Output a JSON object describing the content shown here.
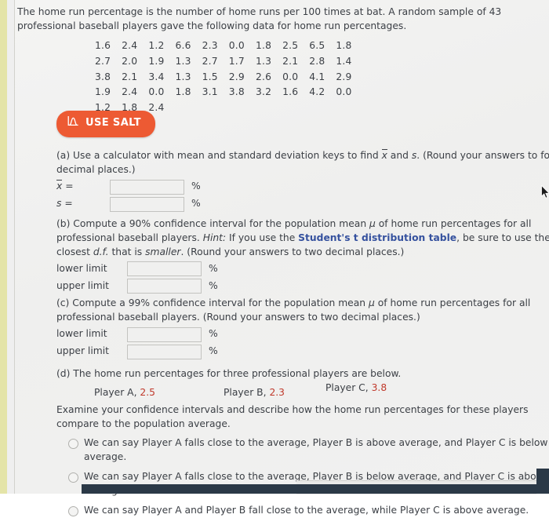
{
  "intro": {
    "text": "The home run percentage is the number of home runs per 100 times at bat. A random sample of 43 professional baseball players gave the following data for home run percentages."
  },
  "data_table": {
    "rows": [
      [
        "1.6",
        "2.4",
        "1.2",
        "6.6",
        "2.3",
        "0.0",
        "1.8",
        "2.5",
        "6.5",
        "1.8"
      ],
      [
        "2.7",
        "2.0",
        "1.9",
        "1.3",
        "2.7",
        "1.7",
        "1.3",
        "2.1",
        "2.8",
        "1.4"
      ],
      [
        "3.8",
        "2.1",
        "3.4",
        "1.3",
        "1.5",
        "2.9",
        "2.6",
        "0.0",
        "4.1",
        "2.9"
      ],
      [
        "1.9",
        "2.4",
        "0.0",
        "1.8",
        "3.1",
        "3.8",
        "3.2",
        "1.6",
        "4.2",
        "0.0"
      ],
      [
        "1.2",
        "1.8",
        "2.4"
      ]
    ]
  },
  "salt_button": {
    "label": "USE SALT",
    "icon": "normal-curve-icon",
    "color": "#ed5a33"
  },
  "part_a": {
    "prompt_1": "(a) Use a calculator with mean and standard deviation keys to find ",
    "symbol_xbar": "x",
    "prompt_2": " and ",
    "symbol_s": "s",
    "prompt_3": ". (Round your answers to four decimal places.)",
    "rows": [
      {
        "label": "x",
        "label_type": "xbar",
        "value": "",
        "unit": "%"
      },
      {
        "label": "s",
        "label_type": "italic",
        "value": "",
        "unit": "%"
      }
    ]
  },
  "part_b": {
    "text_1": "(b) Compute a 90% confidence interval for the population mean ",
    "mu": "μ",
    "text_2": " of home run percentages for all professional baseball players. ",
    "hint_label": "Hint:",
    "text_3": " If you use the ",
    "link": "Student's t distribution table",
    "text_4": ", be sure to use the closest ",
    "df": "d.f.",
    "text_5": " that is ",
    "smaller": "smaller",
    "text_6": ". (Round your answers to two decimal places.)",
    "rows": [
      {
        "label": "lower limit",
        "value": "",
        "unit": "%"
      },
      {
        "label": "upper limit",
        "value": "",
        "unit": "%"
      }
    ]
  },
  "part_c": {
    "text_1": "(c) Compute a 99% confidence interval for the population mean ",
    "mu": "μ",
    "text_2": " of home run percentages for all professional baseball players. (Round your answers to two decimal places.)",
    "rows": [
      {
        "label": "lower limit",
        "value": "",
        "unit": "%"
      },
      {
        "label": "upper limit",
        "value": "",
        "unit": "%"
      }
    ]
  },
  "part_d": {
    "prompt": "(d) The home run percentages for three professional players are below.",
    "players": [
      {
        "name": "Player A,",
        "value": "2.5"
      },
      {
        "name": "Player B,",
        "value": "2.3"
      },
      {
        "name": "Player C,",
        "value": "3.8"
      }
    ],
    "instruction": "Examine your confidence intervals and describe how the home run percentages for these players compare to the population average.",
    "options": [
      "We can say Player A falls close to the average, Player B is above average, and Player C is below average.",
      "We can say Player A falls close to the average, Player B is below average, and Player C is above average.",
      "We can say Player A and Player B fall close to the average, while Player C is above average."
    ]
  }
}
